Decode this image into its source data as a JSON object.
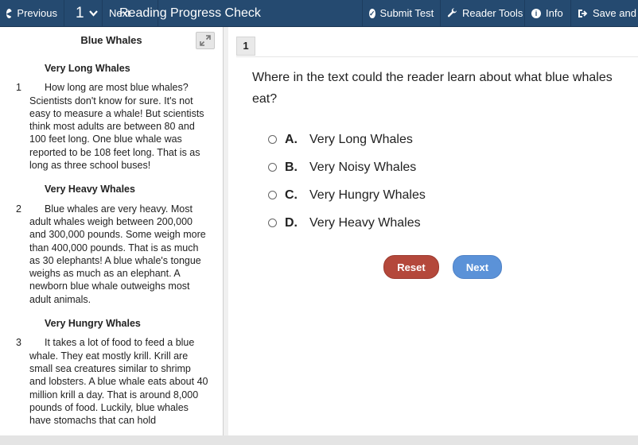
{
  "toolbar": {
    "previous_label": "Previous",
    "question_number": "1",
    "next_label": "Next",
    "app_title": "Reading Progress Check",
    "submit_label": "Submit Test",
    "reader_tools_label": "Reader Tools",
    "info_label": "Info",
    "save_label": "Save and E"
  },
  "passage": {
    "title": "Blue Whales",
    "sections": [
      {
        "heading": "Very Long Whales",
        "number": "1",
        "text": "How long are most blue whales? Scientists don't know for sure. It's not easy to measure a whale! But scientists think most adults are between 80 and 100 feet long. One blue whale was reported to be 108 feet long. That is as long as three school buses!"
      },
      {
        "heading": "Very Heavy Whales",
        "number": "2",
        "text": "Blue whales are very heavy. Most adult whales weigh between 200,000 and 300,000 pounds. Some weigh more than 400,000 pounds. That is as much as 30 elephants! A blue whale's tongue weighs as much as an elephant. A newborn blue whale outweighs most adult animals."
      },
      {
        "heading": "Very Hungry Whales",
        "number": "3",
        "text": "It takes a lot of food to feed a blue whale. They eat mostly krill. Krill are small sea creatures similar to shrimp and lobsters. A blue whale eats about 40 million krill a day. That is around 8,000 pounds of food. Luckily, blue whales have stomachs that can hold"
      }
    ]
  },
  "question": {
    "number": "1",
    "stem": "Where in the text could the reader learn about what blue whales eat?",
    "options": [
      {
        "letter": "A.",
        "text": "Very Long Whales"
      },
      {
        "letter": "B.",
        "text": "Very Noisy Whales"
      },
      {
        "letter": "C.",
        "text": "Very Hungry Whales"
      },
      {
        "letter": "D.",
        "text": "Very Heavy Whales"
      }
    ],
    "reset_label": "Reset",
    "next_label": "Next"
  },
  "colors": {
    "toolbar_bg": "#254a70",
    "reset_button": "#b4483b",
    "next_button": "#5b92d8"
  }
}
